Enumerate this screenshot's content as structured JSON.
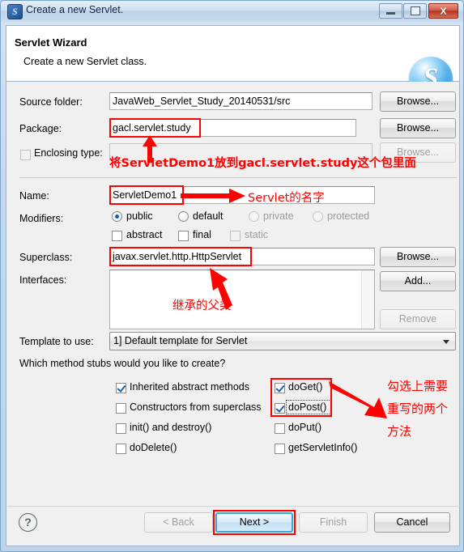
{
  "window": {
    "title": "Create a new Servlet.",
    "app_icon": "servlet-icon",
    "minimize_label": "Minimize",
    "maximize_label": "Maximize",
    "close_label": "X"
  },
  "banner": {
    "title": "Servlet Wizard",
    "subtitle": "Create a new Servlet class.",
    "logo_letter": "S"
  },
  "form": {
    "source_folder": {
      "label": "Source folder:",
      "value": "JavaWeb_Servlet_Study_20140531/src",
      "button": "Browse..."
    },
    "package": {
      "label": "Package:",
      "value": "gacl.servlet.study",
      "button": "Browse..."
    },
    "enclosing_type": {
      "label": "Enclosing type:",
      "value": "",
      "button": "Browse...",
      "checked": false,
      "enabled": false
    },
    "name": {
      "label": "Name:",
      "value": "ServletDemo1"
    },
    "modifiers": {
      "label": "Modifiers:",
      "radios": [
        {
          "label": "public",
          "selected": true,
          "enabled": true
        },
        {
          "label": "default",
          "selected": false,
          "enabled": true
        },
        {
          "label": "private",
          "selected": false,
          "enabled": false
        },
        {
          "label": "protected",
          "selected": false,
          "enabled": false
        }
      ],
      "checkboxes": [
        {
          "label": "abstract",
          "checked": false,
          "enabled": true
        },
        {
          "label": "final",
          "checked": false,
          "enabled": true
        },
        {
          "label": "static",
          "checked": false,
          "enabled": false
        }
      ]
    },
    "superclass": {
      "label": "Superclass:",
      "value": "javax.servlet.http.HttpServlet",
      "button": "Browse..."
    },
    "interfaces": {
      "label": "Interfaces:",
      "items": [],
      "add_button": "Add...",
      "remove_button": "Remove"
    },
    "template": {
      "label": "Template to use:",
      "value": "1] Default template for Servlet"
    }
  },
  "stubs": {
    "question": "Which method stubs would you like to create?",
    "left": [
      {
        "label": "Inherited abstract methods",
        "checked": true
      },
      {
        "label": "Constructors from superclass",
        "checked": false
      },
      {
        "label": "init() and destroy()",
        "checked": false
      },
      {
        "label": "doDelete()",
        "checked": false
      }
    ],
    "right": [
      {
        "label": "doGet()",
        "checked": true
      },
      {
        "label": "doPost()",
        "checked": true
      },
      {
        "label": "doPut()",
        "checked": false
      },
      {
        "label": "getServletInfo()",
        "checked": false
      }
    ]
  },
  "footer": {
    "help": "?",
    "back": "< Back",
    "next": "Next >",
    "finish": "Finish",
    "cancel": "Cancel"
  },
  "annotations": {
    "color": "#ff0000",
    "package_note": "将ServletDemo1放到gacl.servlet.study这个包里面",
    "name_note": "Servlet的名字",
    "superclass_note": "继承的父类",
    "stubs_note_line1": "勾选上需要",
    "stubs_note_line2": "重写的两个",
    "stubs_note_line3": "方法"
  }
}
